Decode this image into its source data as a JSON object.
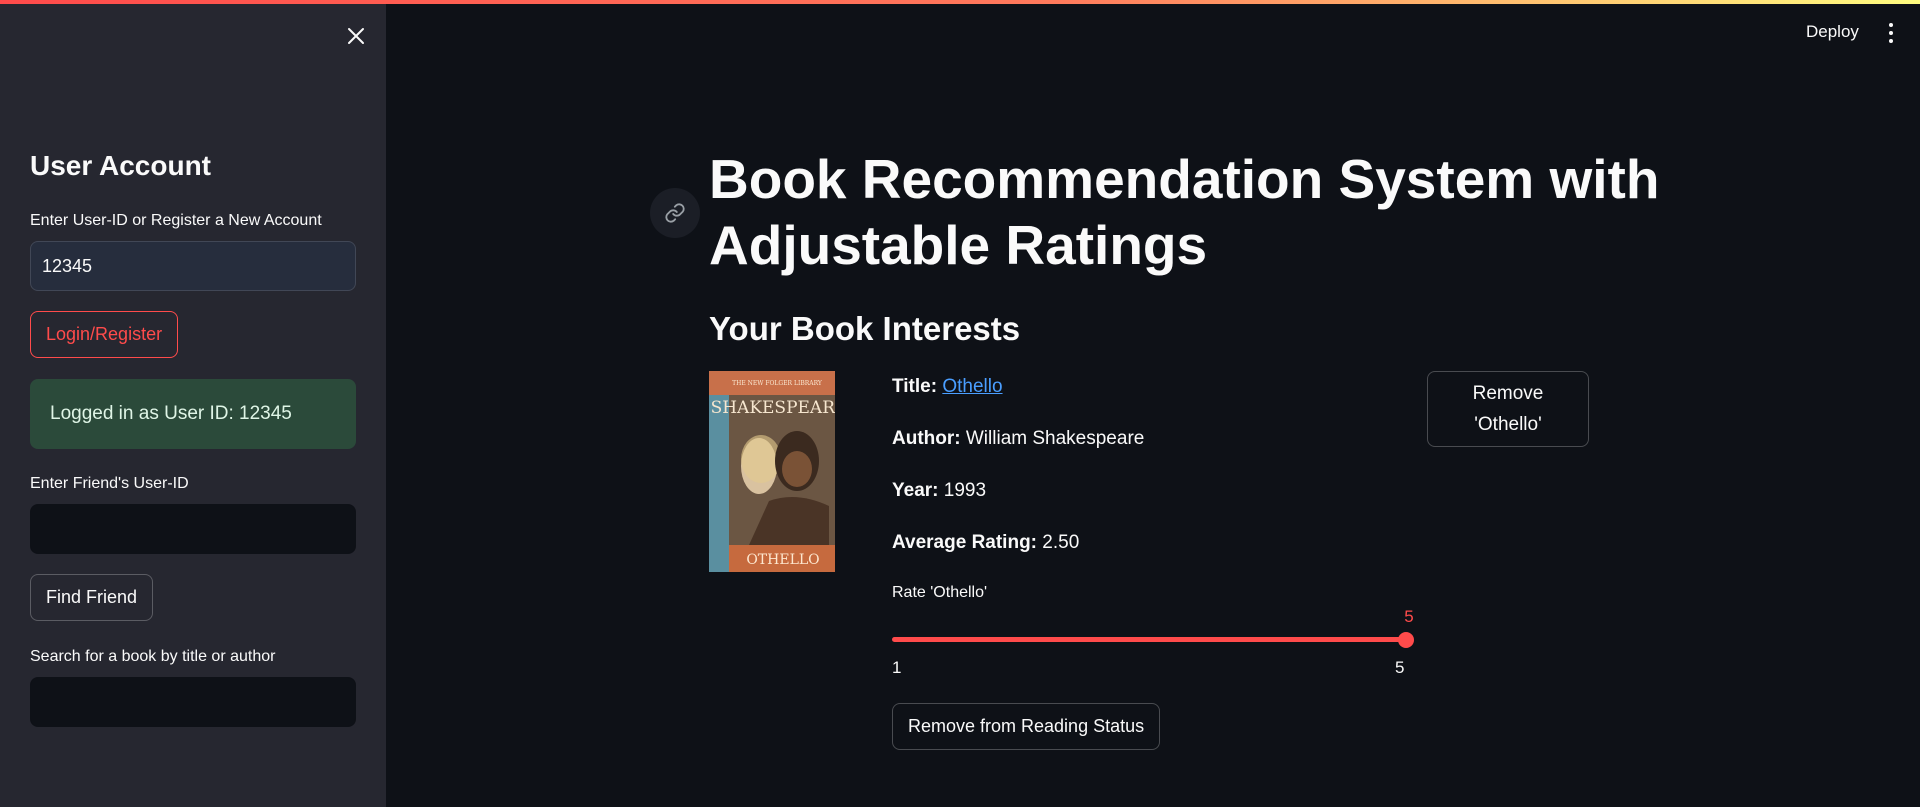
{
  "header": {
    "deploy_label": "Deploy",
    "menu_icon": "vertical-dots-icon"
  },
  "sidebar": {
    "close_icon": "close-icon",
    "heading": "User Account",
    "user_id_label": "Enter User-ID or Register a New Account",
    "user_id_value": "12345",
    "login_button": "Login/Register",
    "success_message": "Logged in as User ID: 12345",
    "friend_label": "Enter Friend's User-ID",
    "friend_value": "",
    "find_friend_button": "Find Friend",
    "search_label": "Search for a book by title or author",
    "search_value": ""
  },
  "main": {
    "title": "Book Recommendation System with Adjustable Ratings",
    "subtitle": "Your Book Interests",
    "book": {
      "cover_text_top": "THE NEW FOLGER LIBRARY",
      "cover_text_main": "SHAKESPEARE",
      "cover_text_bottom": "OTHELLO",
      "title_label": "Title:",
      "title_value": "Othello",
      "author_label": "Author:",
      "author_value": "William Shakespeare",
      "year_label": "Year:",
      "year_value": "1993",
      "rating_label": "Average Rating:",
      "rating_value": "2.50",
      "rate_label": "Rate 'Othello'",
      "slider": {
        "value": "5",
        "min": "1",
        "max": "5",
        "fraction": 1.0
      },
      "remove_reading_button": "Remove from Reading Status",
      "remove_button": "Remove 'Othello'"
    }
  },
  "colors": {
    "accent": "#ff4b4b",
    "background": "#0e1117",
    "sidebar": "#262730",
    "success": "#2b4a3a",
    "link": "#4a9eff"
  }
}
